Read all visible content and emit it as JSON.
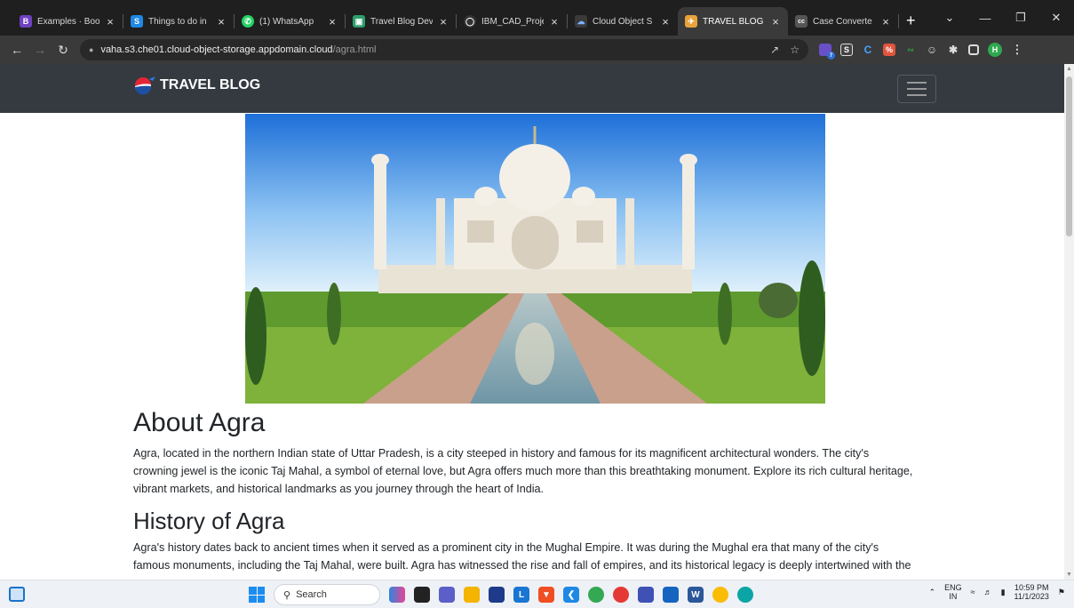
{
  "browser": {
    "tabs": [
      {
        "title": "Examples · Boo",
        "icon": "bootstrap-icon",
        "color": "#6f42c1",
        "glyph": "B",
        "active": false
      },
      {
        "title": "Things to do in",
        "icon": "s-icon",
        "color": "#1e88e5",
        "glyph": "S",
        "active": false
      },
      {
        "title": "(1) WhatsApp",
        "icon": "whatsapp-icon",
        "color": "#25d366",
        "glyph": "✆",
        "active": false
      },
      {
        "title": "Travel Blog Dev",
        "icon": "app-icon",
        "color": "#2e9e6b",
        "glyph": "▣",
        "active": false
      },
      {
        "title": "IBM_CAD_Proje",
        "icon": "github-icon",
        "color": "#333333",
        "glyph": "◯",
        "active": false
      },
      {
        "title": "Cloud Object S",
        "icon": "cloud-icon",
        "color": "#3a3a3a",
        "glyph": "☁",
        "active": false
      },
      {
        "title": "TRAVEL BLOG",
        "icon": "travel-icon",
        "color": "#e8a23a",
        "glyph": "✈",
        "active": true
      },
      {
        "title": "Case Converte",
        "icon": "case-icon",
        "color": "#555555",
        "glyph": "cc",
        "active": false
      }
    ],
    "close_glyph": "×",
    "new_tab_glyph": "+",
    "url_host": "vaha.s3.che01.cloud-object-storage.appdomain.cloud",
    "url_path": "/agra.html",
    "profile_initial": "H",
    "extension_badge": "7"
  },
  "site": {
    "brand": "TRAVEL BLOG",
    "sections": [
      {
        "heading": "About Agra",
        "body": "Agra, located in the northern Indian state of Uttar Pradesh, is a city steeped in history and famous for its magnificent architectural wonders. The city's crowning jewel is the iconic Taj Mahal, a symbol of eternal love, but Agra offers much more than this breathtaking monument. Explore its rich cultural heritage, vibrant markets, and historical landmarks as you journey through the heart of India."
      },
      {
        "heading": "History of Agra",
        "body": "Agra's history dates back to ancient times when it served as a prominent city in the Mughal Empire. It was during the Mughal era that many of the city's famous monuments, including the Taj Mahal, were built. Agra has witnessed the rise and fall of empires, and its historical legacy is deeply intertwined with the"
      }
    ]
  },
  "taskbar": {
    "search_label": "Search",
    "lang_line1": "ENG",
    "lang_line2": "IN",
    "time": "10:59 PM",
    "date": "11/1/2023"
  },
  "colors": {
    "navbar": "#343a40",
    "chrome_dark": "#1f1f1f",
    "toolbar": "#3a3a3a"
  }
}
